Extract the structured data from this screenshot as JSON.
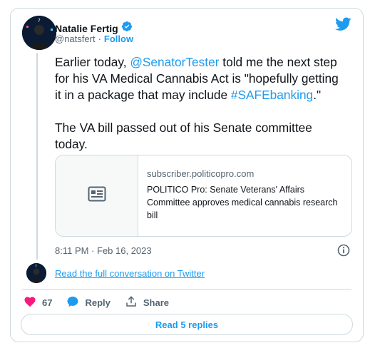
{
  "author": {
    "name": "Natalie Fertig",
    "handle": "@natsfert",
    "separator": "·",
    "follow_label": "Follow"
  },
  "tweet": {
    "text_parts": [
      {
        "t": "Earlier today, ",
        "link": false
      },
      {
        "t": "@SenatorTester",
        "link": true
      },
      {
        "t": " told me the next step for his VA Medical Cannabis Act is \"hopefully getting it in a package that may include ",
        "link": false
      },
      {
        "t": "#SAFEbanking",
        "link": true
      },
      {
        "t": ".\"\n\nThe VA bill passed out of his Senate committee today.",
        "link": false
      }
    ]
  },
  "link_card": {
    "domain": "subscriber.politicopro.com",
    "title": "POLITICO Pro: Senate Veterans' Affairs Committee approves medical cannabis research bill"
  },
  "timestamp": "8:11 PM · Feb 16, 2023",
  "conversation_link": "Read the full conversation on Twitter",
  "actions": {
    "like_count": "67",
    "reply_label": "Reply",
    "share_label": "Share"
  },
  "read_replies_label": "Read 5 replies",
  "colors": {
    "accent": "#1d9bf0",
    "like": "#f91880",
    "verified": "#1d9bf0"
  }
}
